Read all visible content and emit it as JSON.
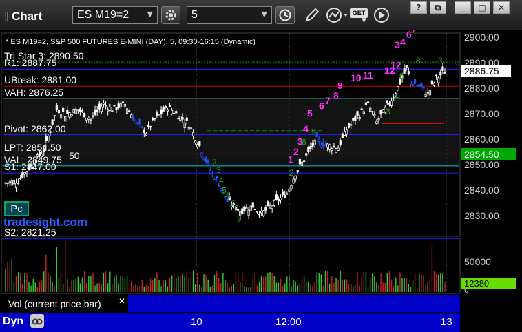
{
  "toolbar": {
    "app_title": "Chart",
    "symbol": "ES M19=2",
    "interval": "5",
    "get_label": "GET"
  },
  "chart_header": "* ES M19=2, S&P 500 FUTURES E-MINI (DAY), 5, 09:30-16:15 (Dynamic)",
  "levels": [
    {
      "label": "Tri Star 3: 2890.50",
      "price": 2890.5,
      "color": "#00aa00",
      "style": "dotted"
    },
    {
      "label": "R1: 2887.75",
      "price": 2887.75,
      "color": "#2020ff",
      "style": "solid"
    },
    {
      "label": "UBreak: 2881.00",
      "price": 2881.0,
      "color": "#cc0000",
      "style": "solid"
    },
    {
      "label": "VAH: 2876.25",
      "price": 2876.25,
      "color": "#00cccc",
      "style": "solid"
    },
    {
      "label": "Pivot: 2862.00",
      "price": 2862.0,
      "color": "#2020ff",
      "style": "solid"
    },
    {
      "label": "LPT: 2854.50",
      "price": 2854.5,
      "color": "#cc0000",
      "style": "solid"
    },
    {
      "label": "VAL: 2849.75",
      "price": 2849.75,
      "color": "#00cccc",
      "style": "solid"
    },
    {
      "label": "S1: 2847.00",
      "price": 2847.0,
      "color": "#2020ff",
      "style": "solid"
    },
    {
      "label": "S2: 2821.25",
      "price": 2821.25,
      "color": "#2020ff",
      "style": "solid"
    }
  ],
  "price_axis": {
    "ticks": [
      "2900.00",
      "2890.00",
      "2880.00",
      "2870.00",
      "2860.00",
      "2850.00",
      "2840.00",
      "2830.00"
    ],
    "last_price": "2886.75",
    "marker_price": "2854.50",
    "marker_color": "#00aa00"
  },
  "time_axis": {
    "ticks": [
      "10",
      "12:00",
      "13"
    ]
  },
  "watermark": "tradesight.com",
  "partial_label": "50",
  "pc_badge": "Pc",
  "volume": {
    "panel_label": "Vol (current price bar)",
    "ticks": [
      "50000",
      "0"
    ],
    "last_volume": "12380"
  },
  "bottom_label": "Dyn",
  "colors": {
    "background": "#000000",
    "panel_blue": "#0000c8",
    "sequential": "#ff00ff",
    "setup": "#00aa00"
  },
  "chart_data": {
    "type": "candlestick",
    "title": "* ES M19=2, S&P 500 FUTURES E-MINI (DAY), 5, 09:30-16:15 (Dynamic)",
    "ylim": [
      2825,
      2902
    ],
    "x_ticks": [
      "10",
      "12:00",
      "13"
    ],
    "close_path": [
      [
        0,
        2843
      ],
      [
        6,
        2844
      ],
      [
        12,
        2850
      ],
      [
        18,
        2856
      ],
      [
        24,
        2872
      ],
      [
        28,
        2870
      ],
      [
        34,
        2872
      ],
      [
        40,
        2868
      ],
      [
        46,
        2874
      ],
      [
        50,
        2872
      ],
      [
        56,
        2874
      ],
      [
        62,
        2866
      ],
      [
        66,
        2863
      ],
      [
        70,
        2868
      ],
      [
        76,
        2873
      ],
      [
        82,
        2869
      ],
      [
        86,
        2866
      ],
      [
        92,
        2856
      ],
      [
        96,
        2848
      ],
      [
        100,
        2843
      ],
      [
        104,
        2836
      ],
      [
        110,
        2832
      ],
      [
        116,
        2834
      ],
      [
        120,
        2831
      ],
      [
        126,
        2835
      ],
      [
        132,
        2839
      ],
      [
        136,
        2847
      ],
      [
        142,
        2855
      ],
      [
        146,
        2860
      ],
      [
        150,
        2858
      ],
      [
        156,
        2857
      ],
      [
        160,
        2864
      ],
      [
        166,
        2870
      ],
      [
        170,
        2874
      ],
      [
        174,
        2867
      ],
      [
        178,
        2872
      ],
      [
        182,
        2877
      ],
      [
        188,
        2888
      ],
      [
        190,
        2883
      ],
      [
        194,
        2881
      ],
      [
        198,
        2878
      ],
      [
        202,
        2884
      ],
      [
        206,
        2887
      ]
    ],
    "volume_ylim": [
      0,
      70000
    ],
    "volume_recent": 12380,
    "sequential_counts": [
      "1",
      "2",
      "3",
      "4",
      "5",
      "6",
      "7",
      "8",
      "9",
      "10",
      "11",
      "12",
      "13"
    ]
  }
}
